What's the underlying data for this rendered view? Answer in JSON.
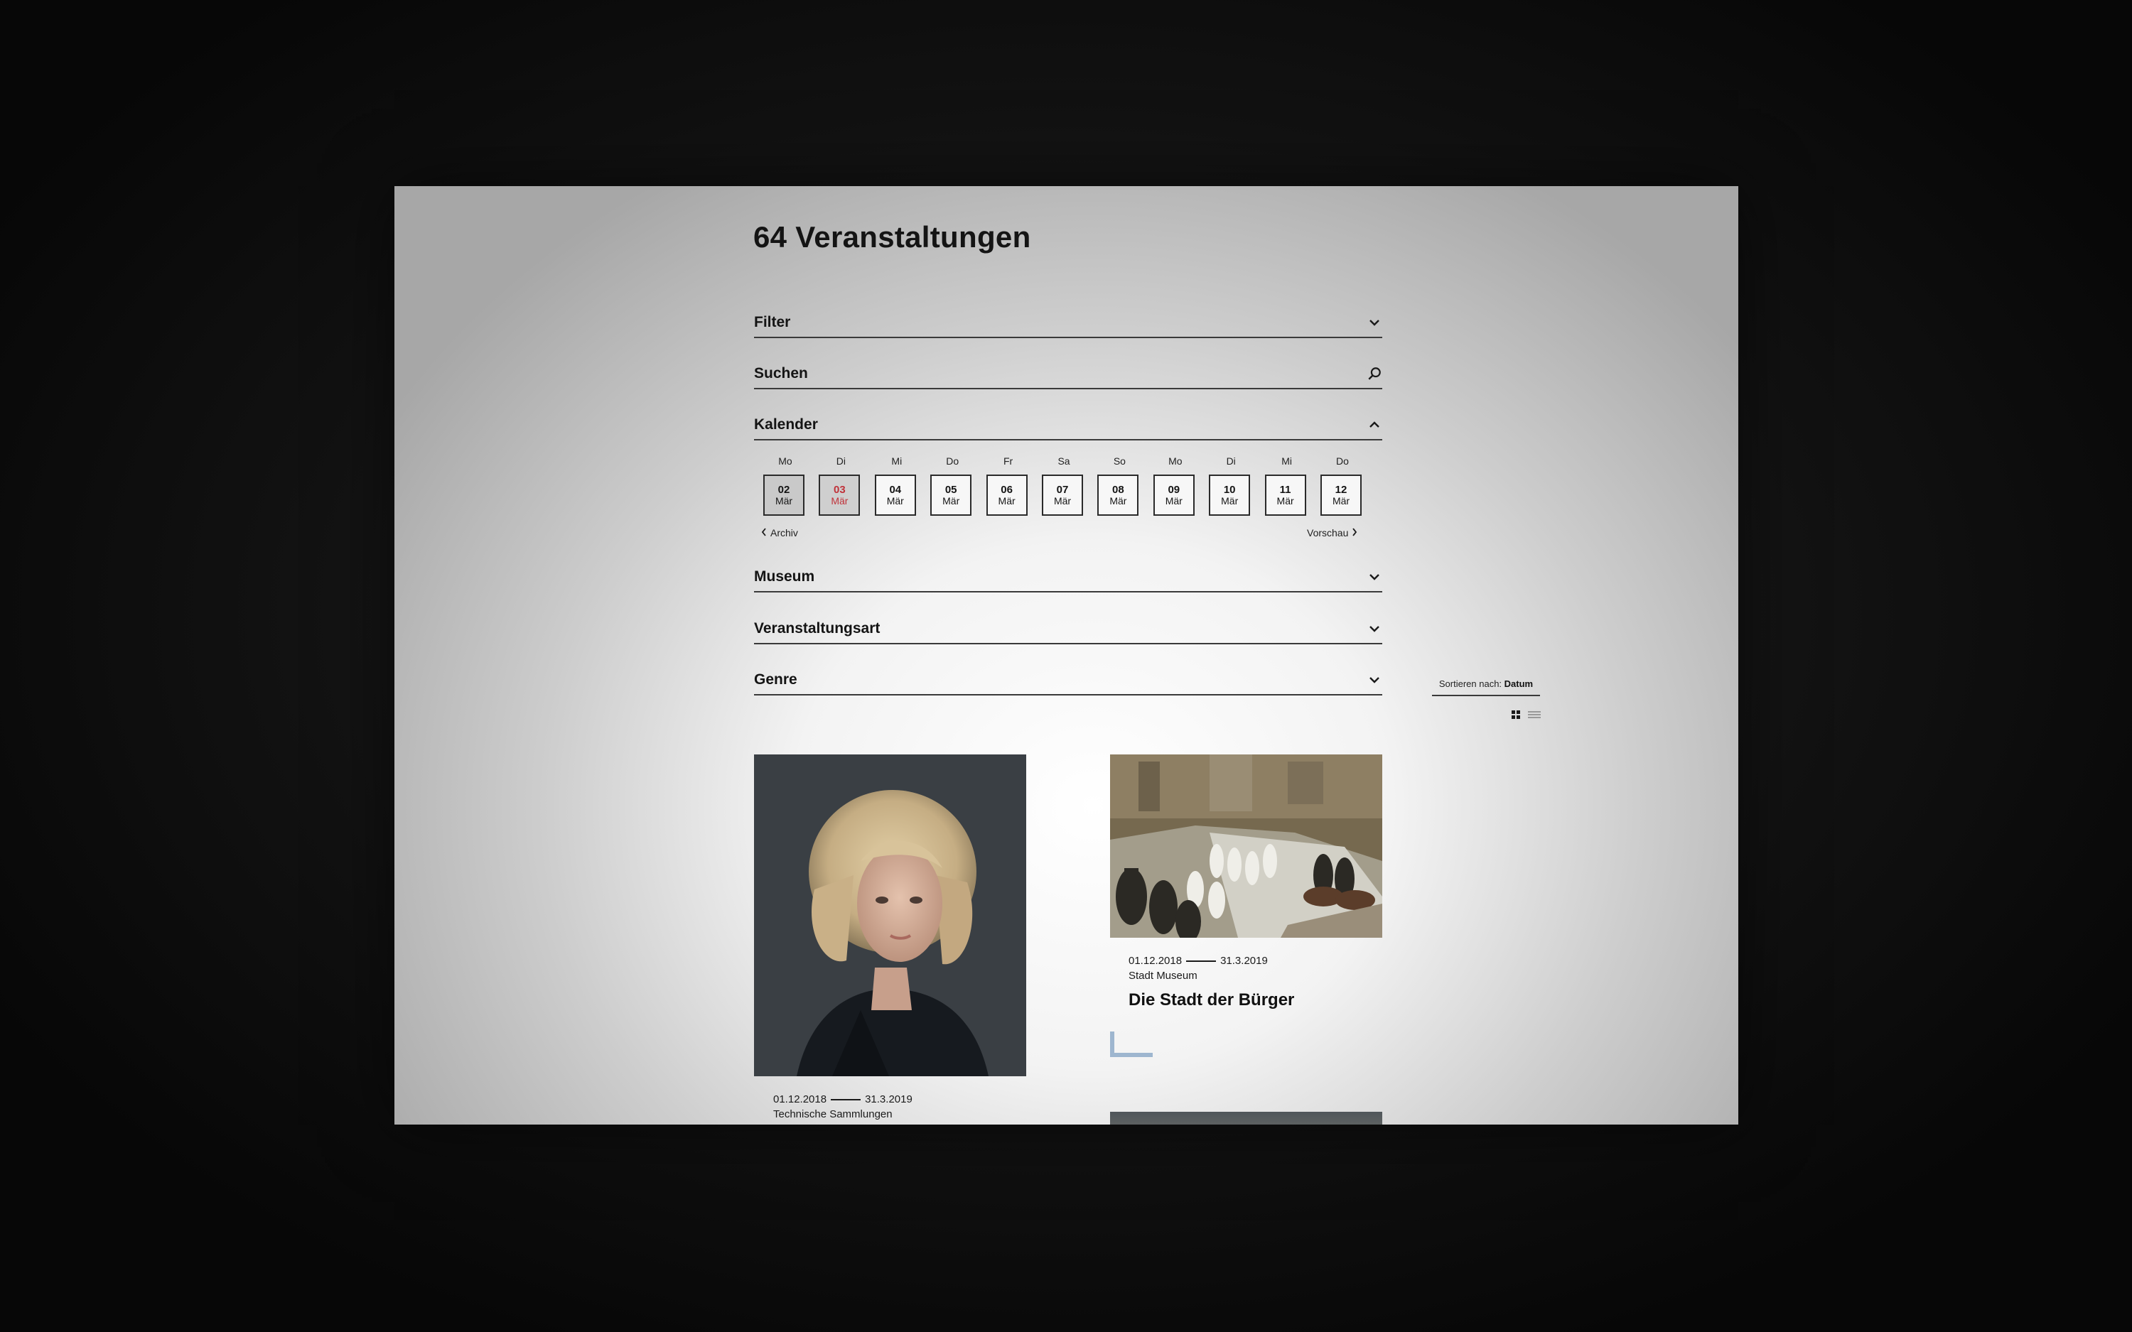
{
  "page": {
    "title": "64 Veranstaltungen"
  },
  "accordion": {
    "filter": "Filter",
    "search": "Suchen",
    "calendar": "Kalender",
    "museum": "Museum",
    "event_type": "Veranstaltungsart",
    "genre": "Genre"
  },
  "calendar": {
    "days": [
      {
        "weekday": "Mo",
        "day": "02",
        "month": "Mär"
      },
      {
        "weekday": "Di",
        "day": "03",
        "month": "Mär"
      },
      {
        "weekday": "Mi",
        "day": "04",
        "month": "Mär"
      },
      {
        "weekday": "Do",
        "day": "05",
        "month": "Mär"
      },
      {
        "weekday": "Fr",
        "day": "06",
        "month": "Mär"
      },
      {
        "weekday": "Sa",
        "day": "07",
        "month": "Mär"
      },
      {
        "weekday": "So",
        "day": "08",
        "month": "Mär"
      },
      {
        "weekday": "Mo",
        "day": "09",
        "month": "Mär"
      },
      {
        "weekday": "Di",
        "day": "10",
        "month": "Mär"
      },
      {
        "weekday": "Mi",
        "day": "11",
        "month": "Mär"
      },
      {
        "weekday": "Do",
        "day": "12",
        "month": "Mär"
      }
    ],
    "prev_label": "Archiv",
    "next_label": "Vorschau",
    "highlight_color": "#c0323a"
  },
  "sort": {
    "prefix": "Sortieren nach:",
    "value": "Datum"
  },
  "events": [
    {
      "date_start": "01.12.2018",
      "date_end": "31.3.2019",
      "museum": "Technische Sammlungen"
    },
    {
      "date_start": "01.12.2018",
      "date_end": "31.3.2019",
      "museum": "Stadt Museum",
      "title": "Die Stadt der Bürger"
    }
  ],
  "colors": {
    "accent_mark": "#9eb6cf",
    "text": "#141414"
  }
}
